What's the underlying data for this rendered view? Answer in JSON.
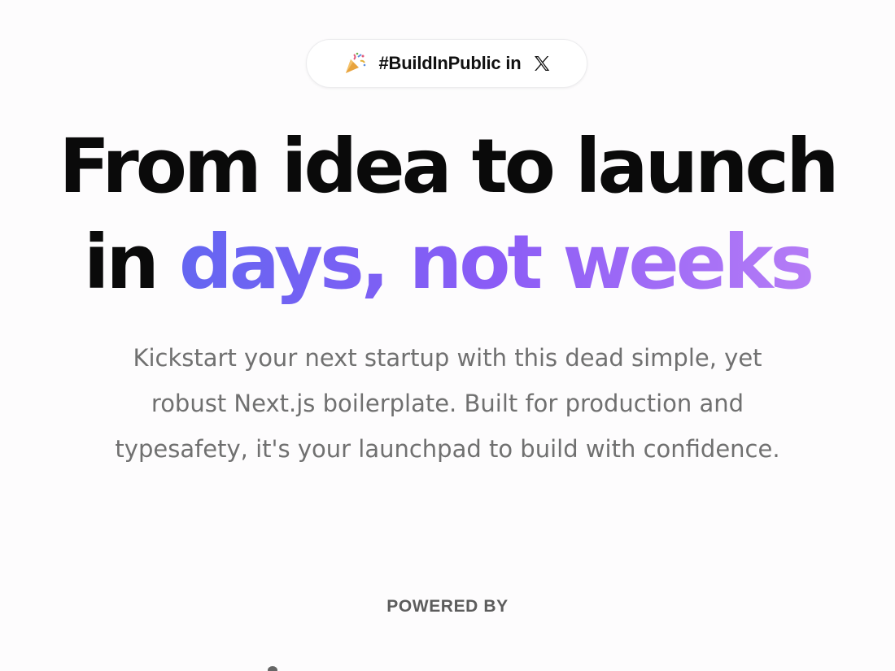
{
  "badge": {
    "emoji_icon": "party-popper-icon",
    "text": "#BuildInPublic in",
    "logo_icon": "x-logo-icon"
  },
  "headline": {
    "line1": "From idea to launch",
    "line2_prefix": "in ",
    "line2_highlight": "days, not weeks",
    "highlight_gradient": [
      "#6466f1",
      "#8b5cf6",
      "#b57cf6"
    ]
  },
  "subtext": {
    "lines": [
      "Kickstart your next startup with this dead simple, yet",
      "robust Next.js boilerplate. Built for production and",
      "typesafety, it's your launchpad to build with confidence."
    ]
  },
  "powered_by": {
    "label": "POWERED BY"
  },
  "colors": {
    "background": "#fdfcfd",
    "headline": "#0a0a0a",
    "subtext": "#707070",
    "powered": "#5c5c5c"
  }
}
